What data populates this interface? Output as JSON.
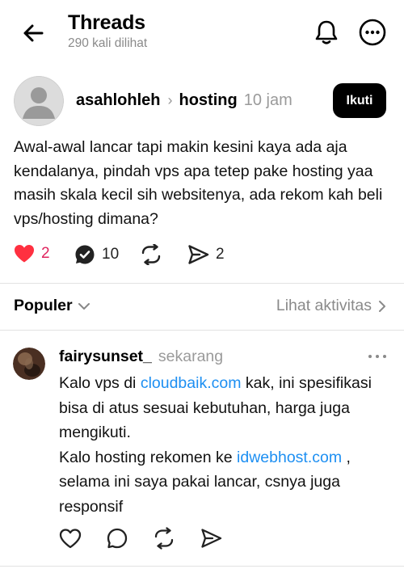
{
  "header": {
    "title": "Threads",
    "views": "290 kali dilihat"
  },
  "post": {
    "username": "asahlohleh",
    "topic": "hosting",
    "time": "10 jam",
    "follow_label": "Ikuti",
    "body": "Awal-awal lancar tapi makin kesini kaya ada aja kendalanya, pindah vps apa tetep pake hosting yaa masih skala kecil sih websitenya, ada rekom kah beli vps/hosting dimana?",
    "likes": "2",
    "replies": "10",
    "shares": "2",
    "like_color": "#e0245e"
  },
  "sort": {
    "label": "Populer",
    "activity_label": "Lihat aktivitas"
  },
  "reply": {
    "username": "fairysunset_",
    "time": "sekarang",
    "body_1": "Kalo vps di ",
    "link_1": "cloudbaik.com",
    "body_2": " kak, ini spesifikasi bisa di atus sesuai kebutuhan, harga juga mengikuti.",
    "body_3": "Kalo hosting rekomen ke ",
    "link_2": "idwebhost.com",
    "body_4": " , selama ini saya pakai lancar, csnya juga responsif",
    "link_color": "#1d8ff2"
  },
  "icons": [
    "back-arrow-icon",
    "bell-icon",
    "more-icon",
    "heart-icon",
    "reply-icon",
    "repost-icon",
    "share-icon",
    "chevron-down-icon",
    "chevron-right-icon"
  ]
}
